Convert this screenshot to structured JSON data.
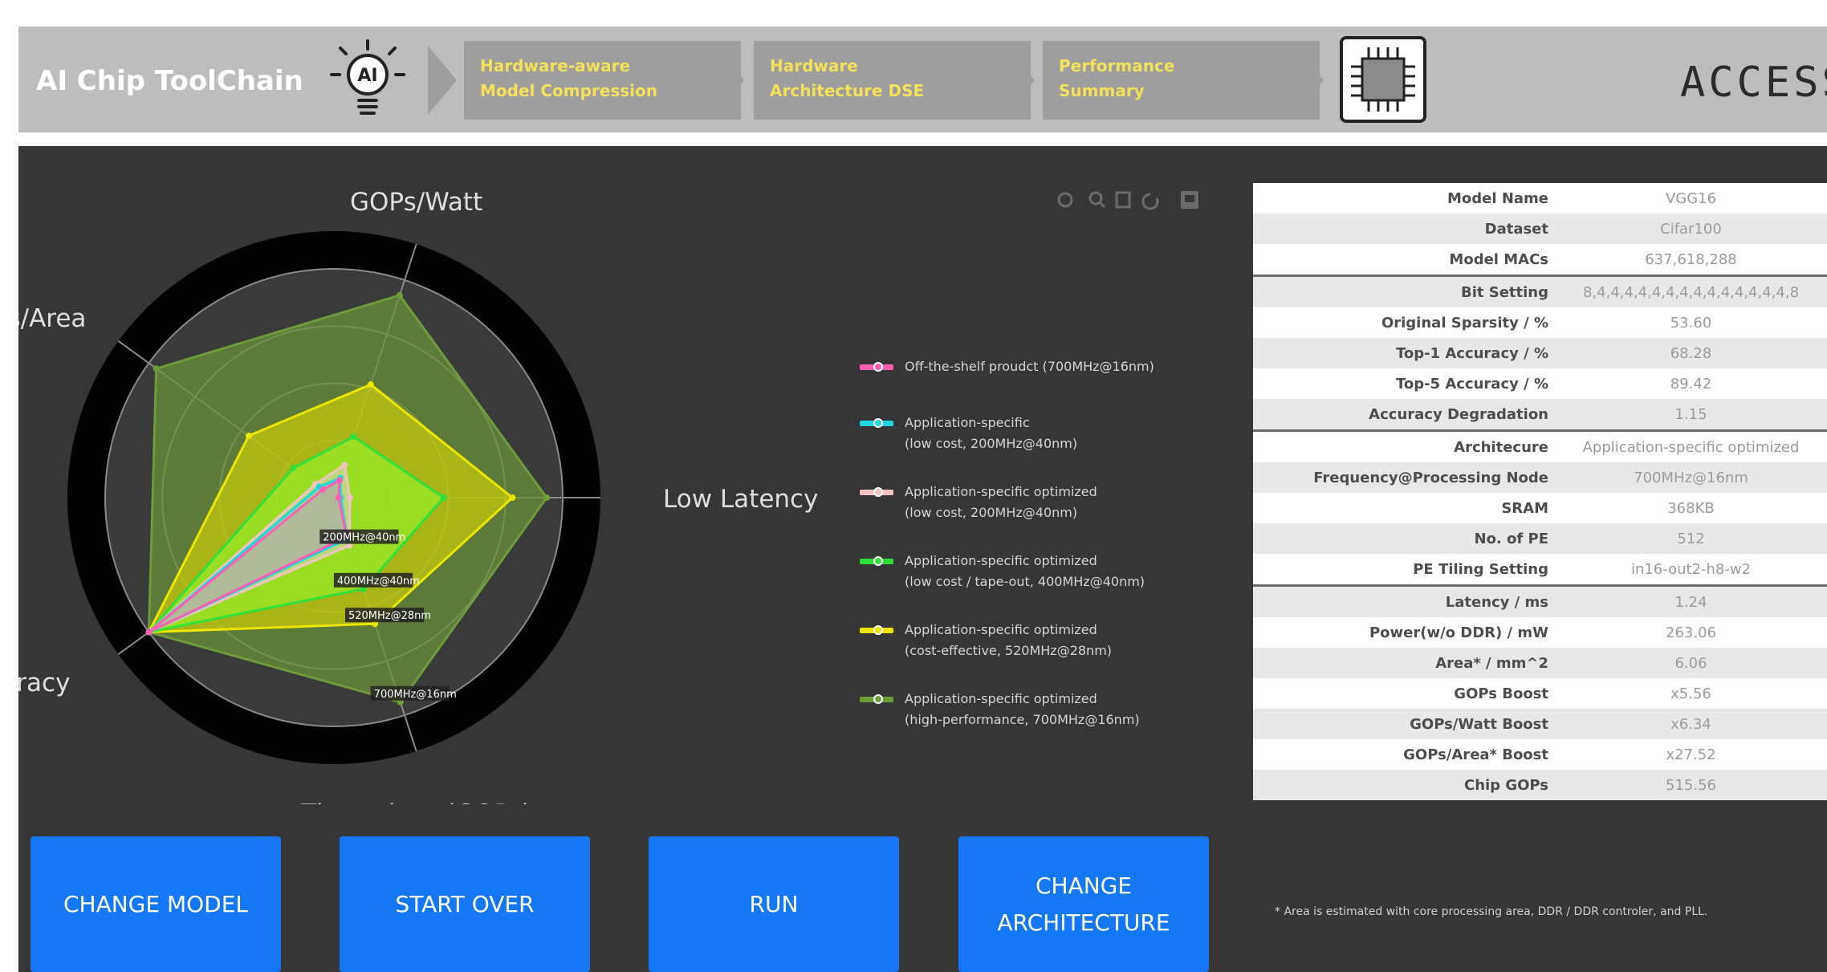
{
  "header": {
    "app_title": "AI Chip ToolChain",
    "steps": [
      {
        "line1": "Hardware-aware",
        "line2": "Model Compression"
      },
      {
        "line1": "Hardware",
        "line2": "Architecture DSE"
      },
      {
        "line1": "Performance",
        "line2": "Summary"
      }
    ],
    "brand": "ACCESS",
    "icons": [
      "ai-bulb-icon",
      "chip-icon"
    ]
  },
  "toolbox": {
    "icons": [
      "restore-icon",
      "zoom-icon",
      "data-view-icon",
      "refresh-icon",
      "save-image-icon"
    ]
  },
  "chart_data": {
    "type": "radar",
    "indicators": [
      "GOPs/Watt",
      "Low Latency",
      "Throughput(GOPs)",
      "Accuracy",
      "GOPs/Area"
    ],
    "max": 100,
    "series": [
      {
        "name": "Off-the-shelf proudct (700MHz@16nm)",
        "color": "#ff5fb0",
        "fill": "rgba(255,95,176,0.25)",
        "values": [
          8,
          2,
          18,
          100,
          6
        ]
      },
      {
        "name": "Application-specific\n(low cost, 200MHz@40nm)",
        "color": "#1fd6df",
        "fill": "rgba(31,214,223,0.25)",
        "values": [
          9,
          3,
          19,
          100,
          8
        ]
      },
      {
        "name": "Application-specific optimized\n(low cost, 200MHz@40nm)",
        "color": "#f2c4c4",
        "fill": "rgba(230,210,230,0.45)",
        "values": [
          15,
          7,
          22,
          100,
          10
        ],
        "label": "200MHz@40nm"
      },
      {
        "name": "Application-specific optimized\n(low cost / tape-out, 400MHz@40nm)",
        "color": "#2fe03a",
        "fill": "rgba(150,235,40,0.75)",
        "values": [
          28,
          48,
          42,
          100,
          22
        ],
        "label": "400MHz@40nm"
      },
      {
        "name": "Application-specific optimized\n(cost-effective, 520MHz@28nm)",
        "color": "#ece600",
        "fill": "rgba(220,220,0,0.60)",
        "values": [
          52,
          78,
          58,
          100,
          46
        ],
        "label": "520MHz@28nm"
      },
      {
        "name": "Application-specific optimized\n(high-performance, 700MHz@16nm)",
        "color": "#6d9c3a",
        "fill": "rgba(110,150,55,0.70)",
        "values": [
          93,
          93,
          94,
          100,
          96
        ],
        "label": "700MHz@16nm"
      }
    ]
  },
  "table": {
    "groups": [
      [
        {
          "key": "Model Name",
          "value": "VGG16"
        },
        {
          "key": "Dataset",
          "value": "Cifar100"
        },
        {
          "key": "Model MACs",
          "value": "637,618,288"
        }
      ],
      [
        {
          "key": "Bit Setting",
          "value": "8,4,4,4,4,4,4,4,4,4,4,4,4,4,4,8"
        },
        {
          "key": "Original Sparsity / %",
          "value": "53.60"
        },
        {
          "key": "Top-1 Accuracy / %",
          "value": "68.28"
        },
        {
          "key": "Top-5 Accuracy / %",
          "value": "89.42"
        },
        {
          "key": "Accuracy Degradation",
          "value": "1.15"
        }
      ],
      [
        {
          "key": "Architecure",
          "value": "Application-specific optimized"
        },
        {
          "key": "Frequency@Processing Node",
          "value": "700MHz@16nm"
        },
        {
          "key": "SRAM",
          "value": "368KB"
        },
        {
          "key": "No. of PE",
          "value": "512"
        },
        {
          "key": "PE Tiling Setting",
          "value": "in16-out2-h8-w2"
        }
      ],
      [
        {
          "key": "Latency / ms",
          "value": "1.24"
        },
        {
          "key": "Power(w/o DDR) / mW",
          "value": "263.06"
        },
        {
          "key": "Area* / mm^2",
          "value": "6.06"
        },
        {
          "key": "GOPs Boost",
          "value": "x5.56"
        },
        {
          "key": "GOPs/Watt Boost",
          "value": "x6.34"
        },
        {
          "key": "GOPs/Area* Boost",
          "value": "x27.52"
        },
        {
          "key": "Chip GOPs",
          "value": "515.56"
        }
      ]
    ],
    "note": "* Area is estimated with core processing area, DDR / DDR controler, and PLL."
  },
  "buttons": {
    "change_model": "CHANGE MODEL",
    "start_over": "START OVER",
    "run": "RUN",
    "change_architecture": "CHANGE ARCHITECTURE"
  },
  "colors": {
    "header_bg": "#bdbdbd",
    "panel_bg": "#363636",
    "button_bg": "#1677f5",
    "step_text": "#f4e25a"
  }
}
